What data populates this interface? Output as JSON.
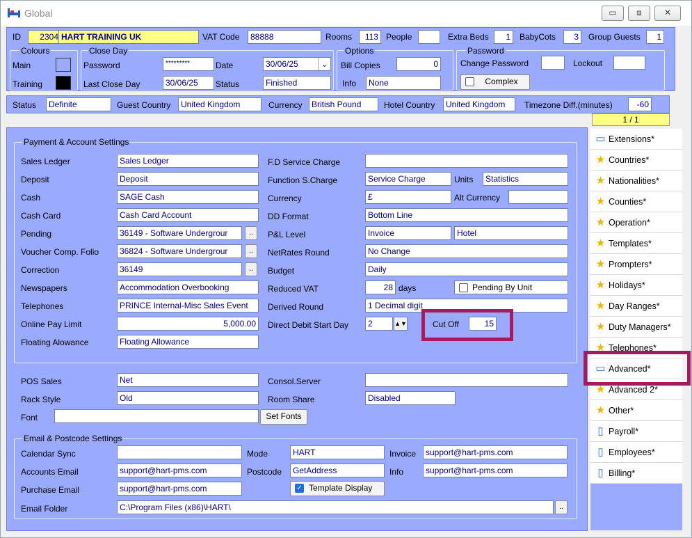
{
  "window": {
    "title": "Global",
    "minimize": "▭",
    "maximize": "⧈",
    "close": "✕"
  },
  "header": {
    "id_label": "ID",
    "id_value": "2304",
    "hotel_name": "HART TRAINING UK",
    "vat_label": "VAT Code",
    "vat_value": "88888",
    "rooms_label": "Rooms",
    "rooms_value": "113",
    "people_label": "People",
    "people_value": "",
    "extra_beds_label": "Extra Beds",
    "extra_beds_value": "1",
    "babycots_label": "BabyCots",
    "babycots_value": "3",
    "group_guests_label": "Group Guests",
    "group_guests_value": "1"
  },
  "colours": {
    "title": "Colours",
    "main_label": "Main",
    "training_label": "Training",
    "main_color": "#99aaff",
    "training_color": "#000000"
  },
  "close_day": {
    "title": "Close Day",
    "password_label": "Password",
    "password_value": "*********",
    "date_label": "Date",
    "date_value": "30/06/25",
    "last_close_label": "Last Close Day",
    "last_close_value": "30/06/25",
    "status_label": "Status",
    "status_value": "Finished"
  },
  "options": {
    "title": "Options",
    "bill_copies_label": "Bill Copies",
    "bill_copies_value": "0",
    "info_label": "Info",
    "info_value": "None"
  },
  "password_grp": {
    "title": "Password",
    "change_label": "Change Password",
    "change_value": "",
    "lockout_label": "Lockout",
    "lockout_value": "",
    "complex_label": "Complex"
  },
  "status_bar": {
    "status_label": "Status",
    "status_value": "Definite",
    "guest_country_label": "Guest Country",
    "guest_country_value": "United Kingdom",
    "currency_label": "Currency",
    "currency_value": "British Pound",
    "hotel_country_label": "Hotel Country",
    "hotel_country_value": "United Kingdom",
    "tz_label": "Timezone Diff.(minutes)",
    "tz_value": "-60",
    "pager": "1 / 1"
  },
  "payment": {
    "title": "Payment & Account Settings",
    "left": [
      {
        "label": "Sales Ledger",
        "value": "Sales Ledger"
      },
      {
        "label": "Deposit",
        "value": "Deposit"
      },
      {
        "label": "Cash",
        "value": "SAGE Cash"
      },
      {
        "label": "Cash Card",
        "value": "Cash Card Account"
      },
      {
        "label": "Pending",
        "value": "36149 - Software Undergrour"
      },
      {
        "label": "Voucher Comp. Folio",
        "value": "36824 - Software Undergrour"
      },
      {
        "label": "Correction",
        "value": "36149"
      },
      {
        "label": "Newspapers",
        "value": "Accommodation Overbooking"
      },
      {
        "label": "Telephones",
        "value": "PRINCE Internal-Misc Sales Event"
      },
      {
        "label": "Online Pay Limit",
        "value": "5,000.00"
      },
      {
        "label": "Floating Alowance",
        "value": "Floating Allowance"
      }
    ],
    "dots": "..",
    "fd_label": "F.D Service Charge",
    "fd_value": "",
    "func_label": "Function S.Charge",
    "func_value": "Service Charge",
    "units_label": "Units",
    "units_value": "Statistics",
    "currency_label": "Currency",
    "currency_value": "£",
    "alt_currency_label": "Alt Currency",
    "alt_currency_value": "",
    "dd_label": "DD Format",
    "dd_value": "Bottom Line",
    "pl_label": "P&L Level",
    "pl_value": "Invoice",
    "pl_value2": "Hotel",
    "netrates_label": "NetRates Round",
    "netrates_value": "No Change",
    "budget_label": "Budget",
    "budget_value": "Daily",
    "reduced_vat_label": "Reduced VAT",
    "reduced_vat_value": "28",
    "days_label": "days",
    "pending_unit_label": "Pending By Unit",
    "derived_label": "Derived Round",
    "derived_value": "1 Decimal digit",
    "dd_start_label": "Direct Debit Start Day",
    "dd_start_value": "2",
    "cutoff_label": "Cut Off",
    "cutoff_value": "15"
  },
  "misc": {
    "pos_label": "POS Sales",
    "pos_value": "Net",
    "consol_label": "Consol.Server",
    "consol_value": "",
    "rack_label": "Rack Style",
    "rack_value": "Old",
    "room_share_label": "Room Share",
    "room_share_value": "Disabled",
    "font_label": "Font",
    "font_value": "",
    "set_fonts": "Set Fonts"
  },
  "email": {
    "title": "Email & Postcode Settings",
    "cal_label": "Calendar Sync",
    "cal_value": "",
    "mode_label": "Mode",
    "mode_value": "HART",
    "invoice_label": "Invoice",
    "invoice_value": "support@hart-pms.com",
    "accounts_label": "Accounts Email",
    "accounts_value": "support@hart-pms.com",
    "postcode_label": "Postcode",
    "postcode_value": "GetAddress",
    "info_label": "Info",
    "info_value": "support@hart-pms.com",
    "purchase_label": "Purchase Email",
    "purchase_value": "support@hart-pms.com",
    "template_label": "Template Display",
    "folder_label": "Email Folder",
    "folder_value": "C:\\Program Files (x86)\\HART\\"
  },
  "sidebar": {
    "items": [
      {
        "label": "Extensions*",
        "icon": "comment-icon"
      },
      {
        "label": "Countries*",
        "icon": "star-icon"
      },
      {
        "label": "Nationalities*",
        "icon": "star-icon"
      },
      {
        "label": "Counties*",
        "icon": "star-icon"
      },
      {
        "label": "Operation*",
        "icon": "star-icon"
      },
      {
        "label": "Templates*",
        "icon": "star-icon"
      },
      {
        "label": "Prompters*",
        "icon": "star-icon"
      },
      {
        "label": "Holidays*",
        "icon": "star-icon"
      },
      {
        "label": "Day Ranges*",
        "icon": "star-icon"
      },
      {
        "label": "Duty Managers*",
        "icon": "star-icon"
      },
      {
        "label": "Telephones*",
        "icon": "star-icon"
      },
      {
        "label": "Advanced*",
        "icon": "comment-icon"
      },
      {
        "label": "Advanced 2*",
        "icon": "star-icon"
      },
      {
        "label": "Other*",
        "icon": "star-icon"
      },
      {
        "label": "Payroll*",
        "icon": "document-icon"
      },
      {
        "label": "Employees*",
        "icon": "document-icon"
      },
      {
        "label": "Billing*",
        "icon": "document-icon"
      }
    ]
  },
  "colors": {
    "panel": "#99aaff",
    "highlight": "#a5195f",
    "field_text": "#00008b",
    "yellow": "#ffff88"
  }
}
